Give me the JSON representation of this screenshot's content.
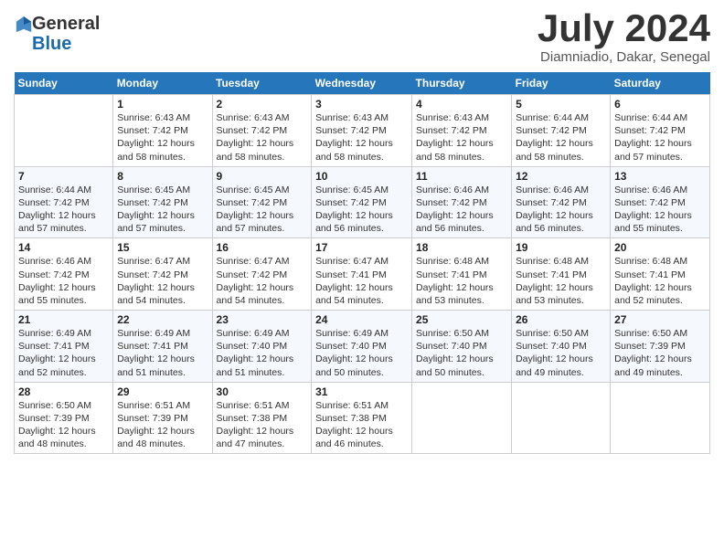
{
  "logo": {
    "general": "General",
    "blue": "Blue"
  },
  "header": {
    "month_year": "July 2024",
    "location": "Diamniadio, Dakar, Senegal"
  },
  "weekdays": [
    "Sunday",
    "Monday",
    "Tuesday",
    "Wednesday",
    "Thursday",
    "Friday",
    "Saturday"
  ],
  "weeks": [
    [
      {
        "day": "",
        "info": ""
      },
      {
        "day": "1",
        "info": "Sunrise: 6:43 AM\nSunset: 7:42 PM\nDaylight: 12 hours\nand 58 minutes."
      },
      {
        "day": "2",
        "info": "Sunrise: 6:43 AM\nSunset: 7:42 PM\nDaylight: 12 hours\nand 58 minutes."
      },
      {
        "day": "3",
        "info": "Sunrise: 6:43 AM\nSunset: 7:42 PM\nDaylight: 12 hours\nand 58 minutes."
      },
      {
        "day": "4",
        "info": "Sunrise: 6:43 AM\nSunset: 7:42 PM\nDaylight: 12 hours\nand 58 minutes."
      },
      {
        "day": "5",
        "info": "Sunrise: 6:44 AM\nSunset: 7:42 PM\nDaylight: 12 hours\nand 58 minutes."
      },
      {
        "day": "6",
        "info": "Sunrise: 6:44 AM\nSunset: 7:42 PM\nDaylight: 12 hours\nand 57 minutes."
      }
    ],
    [
      {
        "day": "7",
        "info": "Sunrise: 6:44 AM\nSunset: 7:42 PM\nDaylight: 12 hours\nand 57 minutes."
      },
      {
        "day": "8",
        "info": "Sunrise: 6:45 AM\nSunset: 7:42 PM\nDaylight: 12 hours\nand 57 minutes."
      },
      {
        "day": "9",
        "info": "Sunrise: 6:45 AM\nSunset: 7:42 PM\nDaylight: 12 hours\nand 57 minutes."
      },
      {
        "day": "10",
        "info": "Sunrise: 6:45 AM\nSunset: 7:42 PM\nDaylight: 12 hours\nand 56 minutes."
      },
      {
        "day": "11",
        "info": "Sunrise: 6:46 AM\nSunset: 7:42 PM\nDaylight: 12 hours\nand 56 minutes."
      },
      {
        "day": "12",
        "info": "Sunrise: 6:46 AM\nSunset: 7:42 PM\nDaylight: 12 hours\nand 56 minutes."
      },
      {
        "day": "13",
        "info": "Sunrise: 6:46 AM\nSunset: 7:42 PM\nDaylight: 12 hours\nand 55 minutes."
      }
    ],
    [
      {
        "day": "14",
        "info": "Sunrise: 6:46 AM\nSunset: 7:42 PM\nDaylight: 12 hours\nand 55 minutes."
      },
      {
        "day": "15",
        "info": "Sunrise: 6:47 AM\nSunset: 7:42 PM\nDaylight: 12 hours\nand 54 minutes."
      },
      {
        "day": "16",
        "info": "Sunrise: 6:47 AM\nSunset: 7:42 PM\nDaylight: 12 hours\nand 54 minutes."
      },
      {
        "day": "17",
        "info": "Sunrise: 6:47 AM\nSunset: 7:41 PM\nDaylight: 12 hours\nand 54 minutes."
      },
      {
        "day": "18",
        "info": "Sunrise: 6:48 AM\nSunset: 7:41 PM\nDaylight: 12 hours\nand 53 minutes."
      },
      {
        "day": "19",
        "info": "Sunrise: 6:48 AM\nSunset: 7:41 PM\nDaylight: 12 hours\nand 53 minutes."
      },
      {
        "day": "20",
        "info": "Sunrise: 6:48 AM\nSunset: 7:41 PM\nDaylight: 12 hours\nand 52 minutes."
      }
    ],
    [
      {
        "day": "21",
        "info": "Sunrise: 6:49 AM\nSunset: 7:41 PM\nDaylight: 12 hours\nand 52 minutes."
      },
      {
        "day": "22",
        "info": "Sunrise: 6:49 AM\nSunset: 7:41 PM\nDaylight: 12 hours\nand 51 minutes."
      },
      {
        "day": "23",
        "info": "Sunrise: 6:49 AM\nSunset: 7:40 PM\nDaylight: 12 hours\nand 51 minutes."
      },
      {
        "day": "24",
        "info": "Sunrise: 6:49 AM\nSunset: 7:40 PM\nDaylight: 12 hours\nand 50 minutes."
      },
      {
        "day": "25",
        "info": "Sunrise: 6:50 AM\nSunset: 7:40 PM\nDaylight: 12 hours\nand 50 minutes."
      },
      {
        "day": "26",
        "info": "Sunrise: 6:50 AM\nSunset: 7:40 PM\nDaylight: 12 hours\nand 49 minutes."
      },
      {
        "day": "27",
        "info": "Sunrise: 6:50 AM\nSunset: 7:39 PM\nDaylight: 12 hours\nand 49 minutes."
      }
    ],
    [
      {
        "day": "28",
        "info": "Sunrise: 6:50 AM\nSunset: 7:39 PM\nDaylight: 12 hours\nand 48 minutes."
      },
      {
        "day": "29",
        "info": "Sunrise: 6:51 AM\nSunset: 7:39 PM\nDaylight: 12 hours\nand 48 minutes."
      },
      {
        "day": "30",
        "info": "Sunrise: 6:51 AM\nSunset: 7:38 PM\nDaylight: 12 hours\nand 47 minutes."
      },
      {
        "day": "31",
        "info": "Sunrise: 6:51 AM\nSunset: 7:38 PM\nDaylight: 12 hours\nand 46 minutes."
      },
      {
        "day": "",
        "info": ""
      },
      {
        "day": "",
        "info": ""
      },
      {
        "day": "",
        "info": ""
      }
    ]
  ]
}
